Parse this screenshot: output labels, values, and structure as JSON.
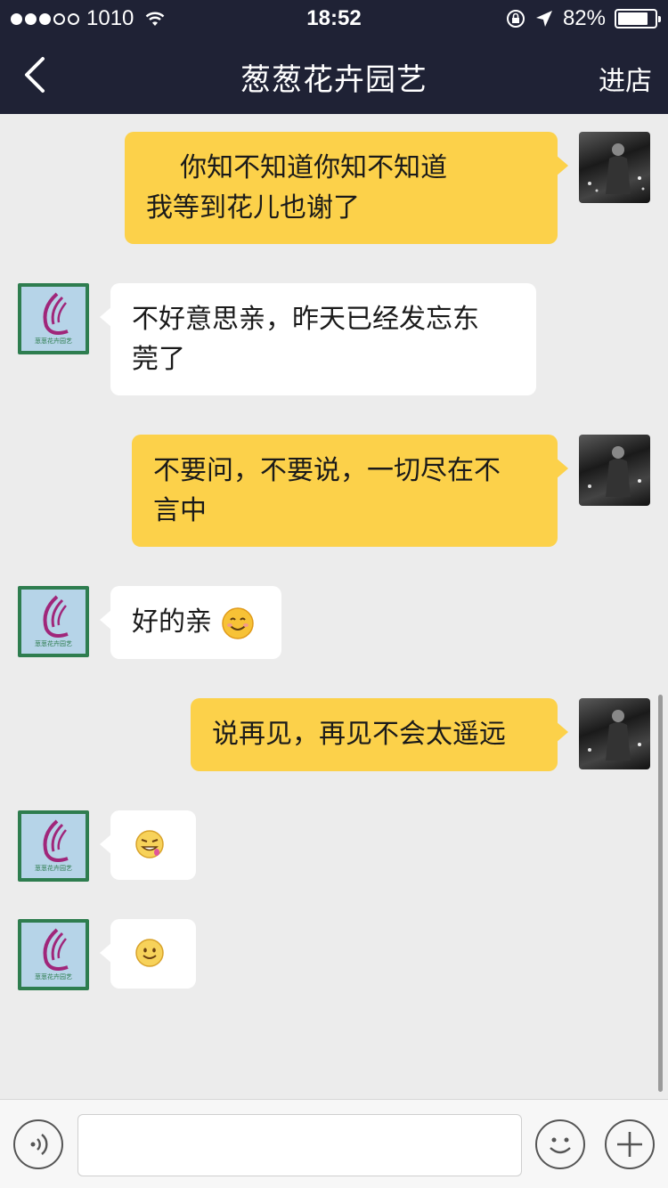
{
  "status_bar": {
    "carrier": "1010",
    "time": "18:52",
    "battery": "82%",
    "battery_level": 0.82,
    "signal_bars_filled": 3,
    "signal_bars_total": 5
  },
  "nav": {
    "back_icon": "chevron-left-icon",
    "title": "葱葱花卉园艺",
    "right_label": "进店"
  },
  "messages": [
    {
      "from": "me",
      "lines": [
        "    你知不知道你知不知道",
        "我等到花儿也谢了"
      ]
    },
    {
      "from": "shop",
      "lines": [
        "不好意思亲，昨天已经发忘东",
        "莞了"
      ]
    },
    {
      "from": "me",
      "lines": [
        "不要问，不要说，一切尽在不",
        "言中"
      ]
    },
    {
      "from": "shop",
      "text": "好的亲",
      "emoji": "smiling-face-icon"
    },
    {
      "from": "me",
      "text": "说再见，再见不会太遥远"
    },
    {
      "from": "shop",
      "emoji": "drooling-face-icon"
    },
    {
      "from": "shop",
      "emoji": "slight-smile-icon"
    }
  ],
  "shop_avatar_logo_text": "葱葱花卉园艺",
  "input_bar": {
    "voice_icon": "voice-icon",
    "emoji_icon": "emoji-icon",
    "plus_icon": "plus-icon",
    "input_value": ""
  },
  "colors": {
    "nav_bg": "#1f2235",
    "chat_bg": "#ececec",
    "outgoing_bubble": "#fcd14a",
    "incoming_bubble": "#ffffff",
    "logo_purple": "#a0267a",
    "logo_green": "#2e7d4f"
  }
}
